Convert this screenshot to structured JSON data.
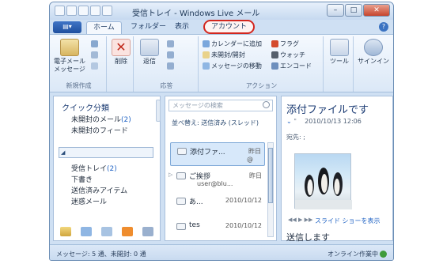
{
  "window": {
    "title": "受信トレイ - Windows Live メール"
  },
  "window_buttons": {
    "minimize": "–",
    "maximize": "□",
    "close": "✕"
  },
  "ribbon_tabs": [
    "ホーム",
    "フォルダー",
    "表示",
    "アカウント"
  ],
  "ribbon": {
    "new_group": {
      "label": "新規作成",
      "button": "電子メール\nメッセージ"
    },
    "delete_group": {
      "button": "削除"
    },
    "reply_group": {
      "label": "応答",
      "button": "返信"
    },
    "actions_group": {
      "label": "アクション",
      "items": [
        "カレンダーに追加",
        "未開封/開封",
        "メッセージの移動",
        "フラグ",
        "ウォッチ",
        "エンコード"
      ]
    },
    "tools": {
      "label": "ツール"
    },
    "signin": {
      "label": "サインイン"
    }
  },
  "nav": {
    "quick_views_header": "クイック分類",
    "unread_mail": "未開封のメール",
    "unread_mail_count": "(2)",
    "unread_feeds": "未開封のフィード",
    "folders": [
      {
        "label": "受信トレイ",
        "count": "(2)"
      },
      {
        "label": "下書き",
        "count": ""
      },
      {
        "label": "送信済みアイテム",
        "count": ""
      },
      {
        "label": "迷惑メール",
        "count": ""
      }
    ]
  },
  "message_list": {
    "search_placeholder": "メッセージの検索",
    "sort_label": "並べ替え: 送信済み (スレッド)",
    "messages": [
      {
        "subject": "添付ファ...",
        "date": "昨日",
        "sub": "@"
      },
      {
        "subject": "ご挨拶",
        "date": "昨日",
        "sub": "user@blu..."
      },
      {
        "subject": "あ...",
        "date": "2010/10/12",
        "sub": ""
      },
      {
        "subject": "tes",
        "date": "2010/10/12",
        "sub": ""
      }
    ]
  },
  "reading_pane": {
    "title": "添付ファイルです",
    "date": "2010/10/13 12:06",
    "to_label": "宛先:",
    "slideshow_link": "スライド ショーを表示",
    "body_heading": "送信します"
  },
  "status": {
    "left": "メッセージ: 5 通、未開封: 0 通",
    "right": "オンライン作業中"
  },
  "colors": {
    "accent": "#2466c5",
    "highlight_circle": "#d3261e"
  }
}
